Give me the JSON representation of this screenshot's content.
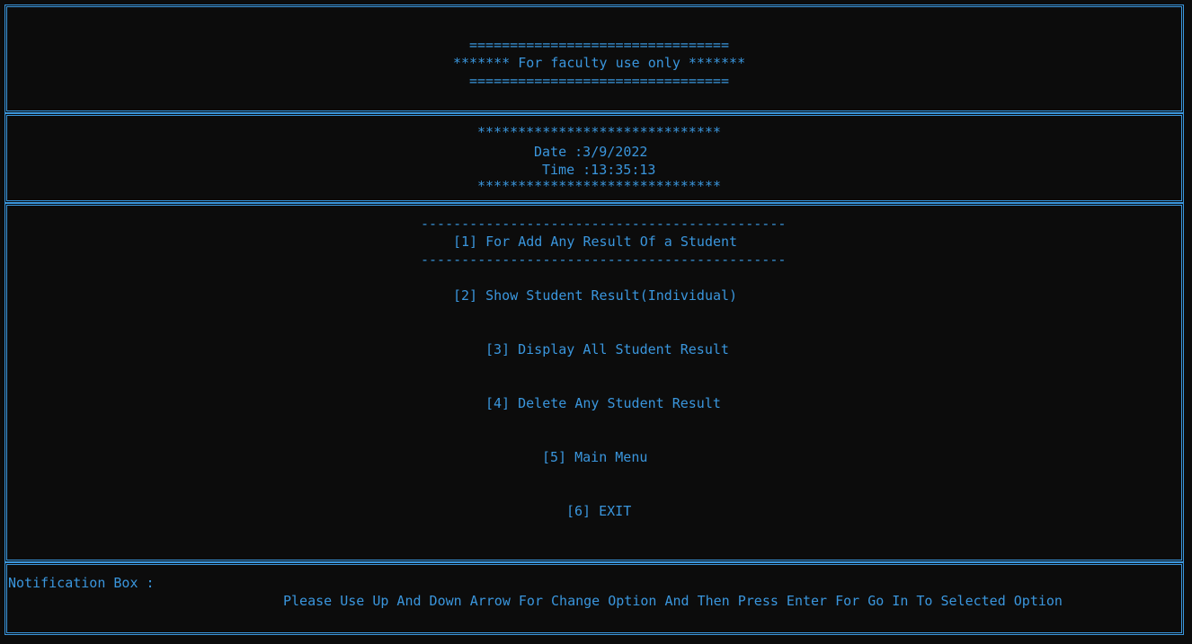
{
  "header": {
    "rule_top": "================================",
    "title": "******* For faculty use only *******",
    "rule_bottom": "================================"
  },
  "datetime": {
    "stars_top": "******************************",
    "date": "Date :3/9/2022",
    "time": "Time :13:35:13",
    "stars_bottom": "******************************"
  },
  "menu": {
    "selected_rule": "---------------------------------------------",
    "items": [
      {
        "label": "[1] For Add Any Result Of a Student"
      },
      {
        "label": "[2] Show Student Result(Individual)"
      },
      {
        "label": "[3] Display All Student Result"
      },
      {
        "label": "[4] Delete Any Student Result"
      },
      {
        "label": "[5] Main Menu"
      },
      {
        "label": "[6] EXIT"
      }
    ]
  },
  "notification": {
    "label": "Notification Box :",
    "message": "Please Use Up And Down Arrow For Change Option And Then Press Enter For Go In To Selected Option"
  },
  "colors": {
    "background": "#0c0c0c",
    "foreground": "#3a96dd"
  }
}
